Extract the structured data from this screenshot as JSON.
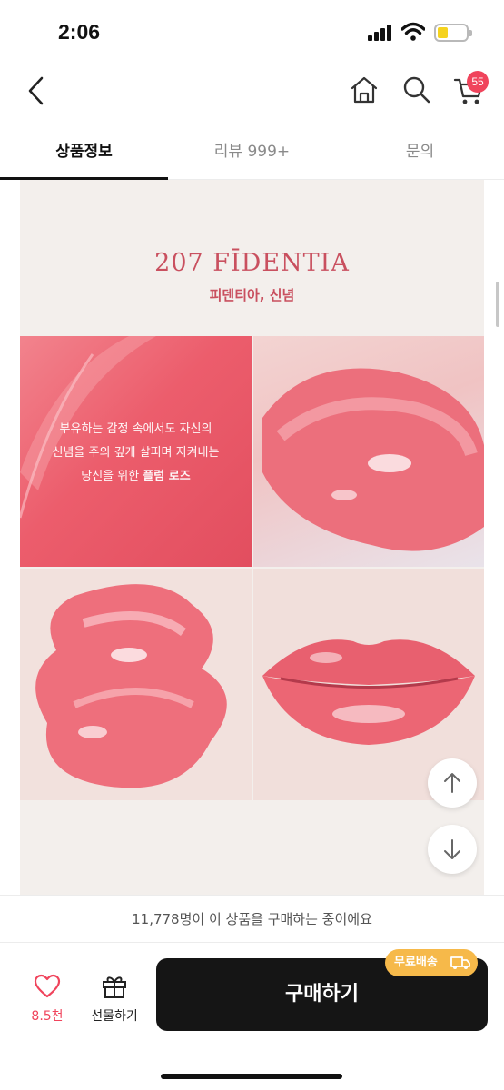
{
  "status_bar": {
    "time": "2:06"
  },
  "nav": {
    "back_icon": "chevron-left-icon",
    "home_icon": "home-icon",
    "search_icon": "search-icon",
    "cart_icon": "cart-icon",
    "cart_count": "55",
    "badge_color": "#f0445c"
  },
  "tabs": [
    {
      "label": "상품정보",
      "active": true
    },
    {
      "label": "리뷰 999+",
      "active": false
    },
    {
      "label": "문의",
      "active": false
    }
  ],
  "content": {
    "shade_title": "207 FĪDENTIA",
    "shade_subtitle": "피덴티아, 신념",
    "copy_line1": "부유하는 감정 속에서도 자신의",
    "copy_line2": "신념을 주의 깊게 살피며 지켜내는",
    "copy_line3_prefix": "당신을 위한 ",
    "copy_line3_bold": "플럼 로즈",
    "accent_color": "#c9505f"
  },
  "floating": {
    "up_icon": "arrow-up-icon",
    "down_icon": "arrow-down-icon"
  },
  "footer": {
    "notice": "11,778명이 이 상품을 구매하는 중이에요",
    "like_count": "8.5천",
    "gift_label": "선물하기",
    "buy_label": "구매하기",
    "shipping_badge": "무료배송",
    "shipping_badge_color": "#f6b94a"
  }
}
